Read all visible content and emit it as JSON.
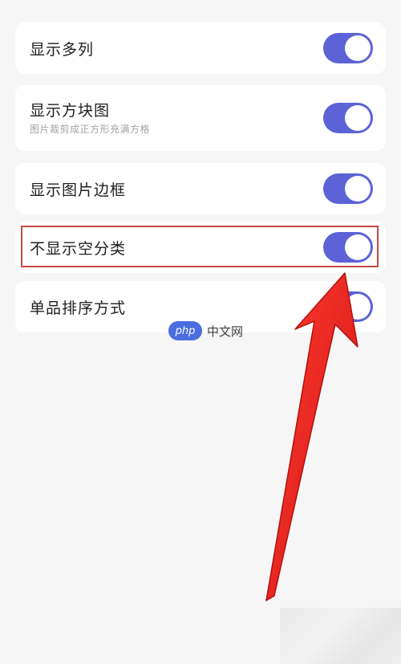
{
  "settings": [
    {
      "label": "显示多列",
      "sublabel": "",
      "enabled": true
    },
    {
      "label": "显示方块图",
      "sublabel": "图片裁剪成正方形充满方格",
      "enabled": true
    },
    {
      "label": "显示图片边框",
      "sublabel": "",
      "enabled": true
    },
    {
      "label": "不显示空分类",
      "sublabel": "",
      "enabled": true
    },
    {
      "label": "单品排序方式",
      "sublabel": "",
      "enabled": true
    }
  ],
  "watermark": {
    "logo": "php",
    "text": "中文网"
  },
  "colors": {
    "toggle_on": "#5b63d6",
    "highlight": "#c94848",
    "arrow": "#e8231e",
    "background": "#f6f6f7"
  },
  "icons": {
    "annotation": "red-arrow-icon"
  }
}
